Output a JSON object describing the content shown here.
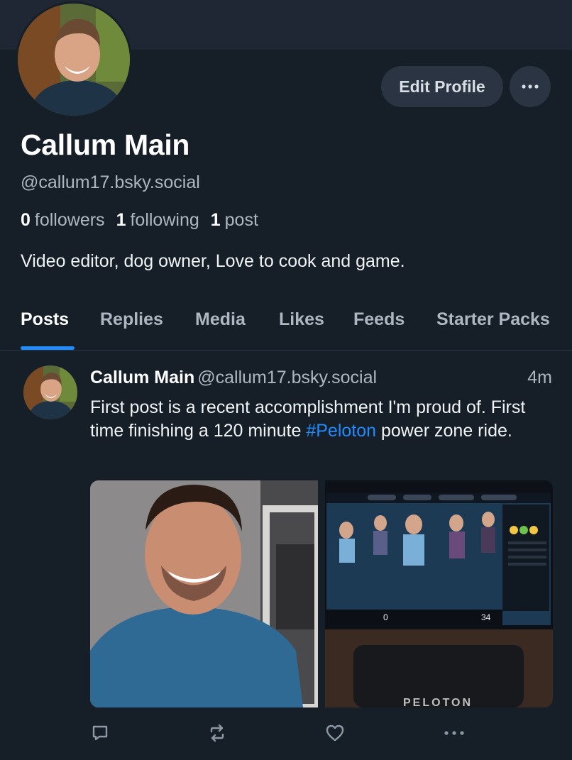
{
  "profile": {
    "display_name": "Callum Main",
    "handle": "@callum17.bsky.social",
    "followers_count": "0",
    "followers_label": "followers",
    "following_count": "1",
    "following_label": "following",
    "posts_count": "1",
    "posts_label": "post",
    "bio": "Video editor, dog owner, Love to cook and game.",
    "edit_button_label": "Edit Profile"
  },
  "tabs": [
    {
      "label": "Posts",
      "active": true
    },
    {
      "label": "Replies",
      "active": false
    },
    {
      "label": "Media",
      "active": false
    },
    {
      "label": "Likes",
      "active": false
    },
    {
      "label": "Feeds",
      "active": false
    },
    {
      "label": "Starter Packs",
      "active": false
    }
  ],
  "post": {
    "author": "Callum Main",
    "handle": "@callum17.bsky.social",
    "time": "4m",
    "text_before": "First post is a recent accomplishment I'm proud of. First time finishing a 120 minute ",
    "hashtag": "#Peloton",
    "text_after": " power zone ride.",
    "image2_brand_text": "PELOTON",
    "image2_screen_number_a": "0",
    "image2_screen_number_b": "34"
  },
  "icons": {
    "more": "more-horizontal-icon",
    "reply": "reply-icon",
    "repost": "repost-icon",
    "like": "heart-icon",
    "post_more": "more-horizontal-icon"
  },
  "colors": {
    "background": "#161e27",
    "banner": "#1e2733",
    "accent": "#208bfe",
    "muted_text": "#aeb7c1",
    "button_bg": "#2a3442"
  }
}
